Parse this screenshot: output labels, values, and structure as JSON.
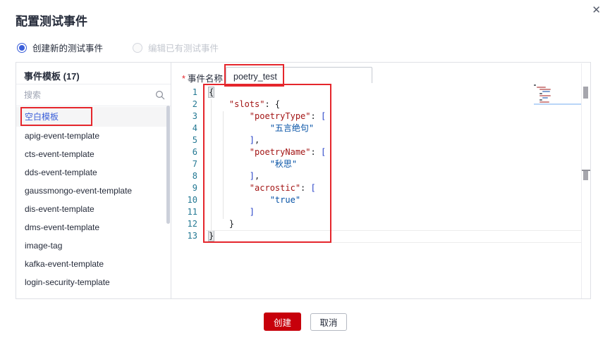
{
  "dialog": {
    "title": "配置测试事件",
    "close_icon": "✕"
  },
  "radios": [
    {
      "label": "创建新的测试事件",
      "selected": true,
      "disabled": false
    },
    {
      "label": "编辑已有测试事件",
      "selected": false,
      "disabled": true
    }
  ],
  "templates_panel": {
    "header": "事件模板 (17)",
    "search_placeholder": "搜索",
    "search_icon": "magnifier",
    "items": [
      {
        "label": "空白模板",
        "selected": true,
        "annotated": true
      },
      {
        "label": "apig-event-template"
      },
      {
        "label": "cts-event-template"
      },
      {
        "label": "dds-event-template"
      },
      {
        "label": "gaussmongo-event-template"
      },
      {
        "label": "dis-event-template"
      },
      {
        "label": "dms-event-template"
      },
      {
        "label": "image-tag"
      },
      {
        "label": "kafka-event-template"
      },
      {
        "label": "login-security-template"
      }
    ]
  },
  "event_name": {
    "required_mark": "*",
    "label": "事件名称",
    "value": "poetry_test"
  },
  "editor": {
    "language": "json",
    "lines": [
      [
        [
          "p bm",
          "{"
        ]
      ],
      [
        [
          "w",
          "    "
        ],
        [
          "k",
          "\"slots\""
        ],
        [
          "p",
          ": {"
        ]
      ],
      [
        [
          "w",
          "        "
        ],
        [
          "k",
          "\"poetryType\""
        ],
        [
          "p",
          ": "
        ],
        [
          "b",
          "["
        ]
      ],
      [
        [
          "w",
          "            "
        ],
        [
          "v",
          "\"五言绝句\""
        ]
      ],
      [
        [
          "w",
          "        "
        ],
        [
          "b",
          "]"
        ],
        [
          "p",
          ","
        ]
      ],
      [
        [
          "w",
          "        "
        ],
        [
          "k",
          "\"poetryName\""
        ],
        [
          "p",
          ": "
        ],
        [
          "b",
          "["
        ]
      ],
      [
        [
          "w",
          "            "
        ],
        [
          "v",
          "\"秋思\""
        ]
      ],
      [
        [
          "w",
          "        "
        ],
        [
          "b",
          "]"
        ],
        [
          "p",
          ","
        ]
      ],
      [
        [
          "w",
          "        "
        ],
        [
          "k",
          "\"acrostic\""
        ],
        [
          "p",
          ": "
        ],
        [
          "b",
          "["
        ]
      ],
      [
        [
          "w",
          "            "
        ],
        [
          "v",
          "\"true\""
        ]
      ],
      [
        [
          "w",
          "        "
        ],
        [
          "b",
          "]"
        ]
      ],
      [
        [
          "w",
          "    "
        ],
        [
          "p",
          "}"
        ]
      ],
      [
        [
          "p bm",
          "}"
        ]
      ]
    ],
    "current_line": 13,
    "minimap_rows": [
      {
        "indent": 0,
        "width": 3,
        "color": "#55585f"
      },
      {
        "indent": 4,
        "width": 13,
        "color": "#d08a8a"
      },
      {
        "indent": 8,
        "width": 16,
        "color": "#d08a8a"
      },
      {
        "indent": 12,
        "width": 11,
        "color": "#7f9fd0"
      },
      {
        "indent": 8,
        "width": 4,
        "color": "#6b6f78"
      },
      {
        "indent": 8,
        "width": 16,
        "color": "#d08a8a"
      },
      {
        "indent": 12,
        "width": 8,
        "color": "#7f9fd0"
      },
      {
        "indent": 8,
        "width": 4,
        "color": "#6b6f78"
      },
      {
        "indent": 8,
        "width": 14,
        "color": "#d08a8a"
      },
      {
        "indent": 12,
        "width": 7,
        "color": "#7f9fd0"
      }
    ]
  },
  "footer": {
    "create_label": "创建",
    "cancel_label": "取消"
  },
  "colors": {
    "accent_blue": "#3b5fd9",
    "primary_button_red": "#c7000b",
    "annotation_red": "#e5262c",
    "json_key": "#a31515",
    "json_value": "#0451a5",
    "line_number": "#237893",
    "border": "#dfe1e6"
  }
}
